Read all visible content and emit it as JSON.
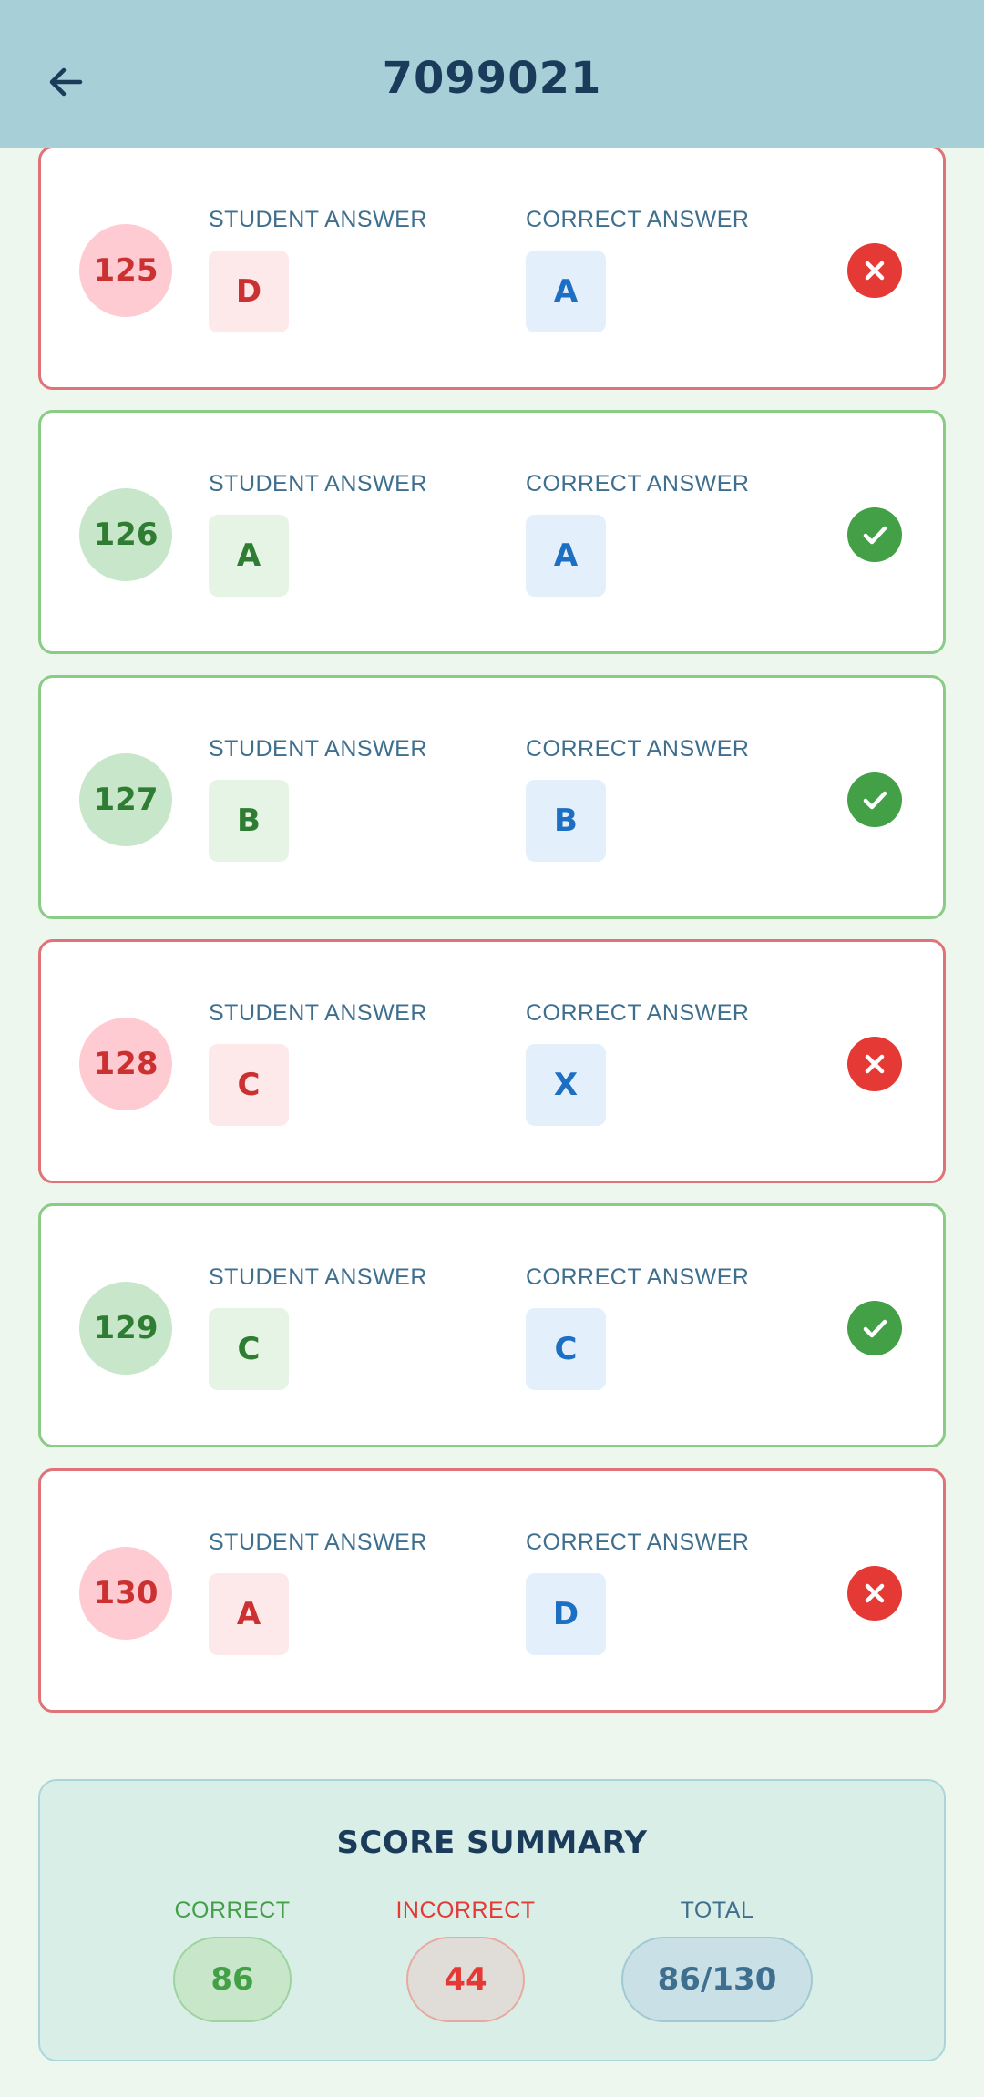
{
  "header": {
    "title": "7099021",
    "back_icon": "arrow-left-icon"
  },
  "colors": {
    "app_bar": "#a6cfd7",
    "correct": "#43a047",
    "incorrect": "#e53935",
    "answer_blue": "#1d6fc4"
  },
  "labels": {
    "student_answer": "STUDENT ANSWER",
    "correct_answer": "CORRECT ANSWER"
  },
  "questions": [
    {
      "number": "125",
      "student": "D",
      "correct": "A",
      "status": "incorrect"
    },
    {
      "number": "126",
      "student": "A",
      "correct": "A",
      "status": "correct"
    },
    {
      "number": "127",
      "student": "B",
      "correct": "B",
      "status": "correct"
    },
    {
      "number": "128",
      "student": "C",
      "correct": "X",
      "status": "incorrect"
    },
    {
      "number": "129",
      "student": "C",
      "correct": "C",
      "status": "correct"
    },
    {
      "number": "130",
      "student": "A",
      "correct": "D",
      "status": "incorrect"
    }
  ],
  "summary": {
    "title": "SCORE SUMMARY",
    "correct_label": "CORRECT",
    "correct_value": "86",
    "incorrect_label": "INCORRECT",
    "incorrect_value": "44",
    "total_label": "TOTAL",
    "total_value": "86/130"
  }
}
